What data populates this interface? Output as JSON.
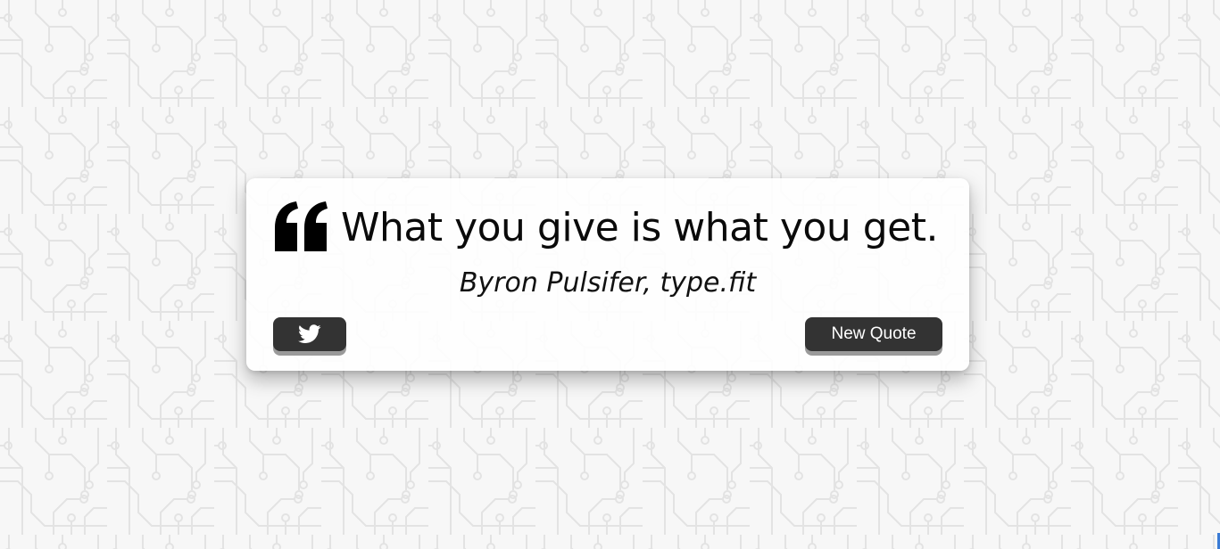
{
  "quote": {
    "text": "What you give is what you get.",
    "author": "Byron Pulsifer, type.fit"
  },
  "buttons": {
    "tweet_icon": "twitter-bird-icon",
    "new_quote_label": "New Quote"
  },
  "colors": {
    "button_bg": "#333333",
    "button_text": "#ffffff",
    "page_bg": "#f7f7f7",
    "pattern_stroke": "#e4e4e4"
  },
  "icons": {
    "quote": "quote-left-icon",
    "tweet": "twitter-icon"
  }
}
